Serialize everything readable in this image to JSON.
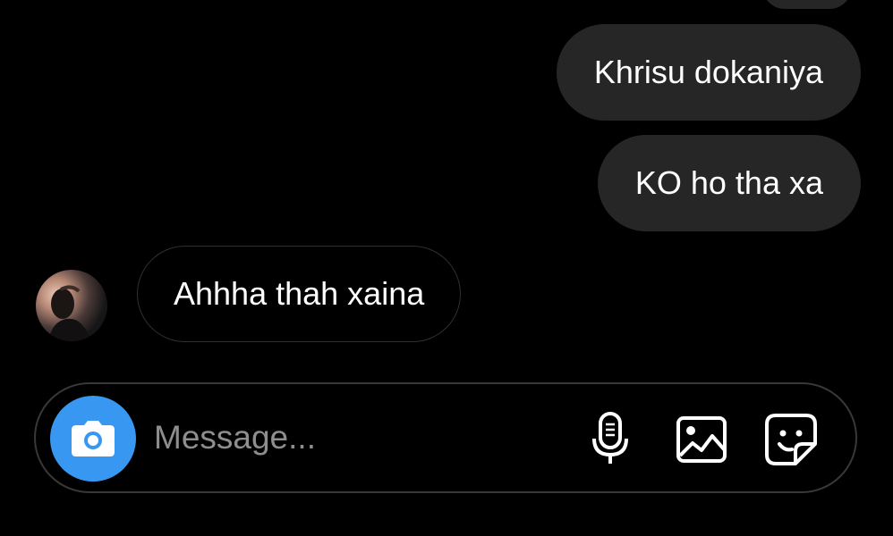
{
  "thread": {
    "outgoing": [
      {
        "text": "Khrisu dokaniya"
      },
      {
        "text": "KO ho tha xa"
      }
    ],
    "incoming": [
      {
        "text": "Ahhha thah xaina"
      }
    ]
  },
  "composer": {
    "placeholder": "Message...",
    "icons": [
      "camera-icon",
      "microphone-icon",
      "gallery-icon",
      "sticker-icon"
    ]
  },
  "colors": {
    "background": "#000000",
    "outgoing_bubble": "#262626",
    "incoming_border": "#303030",
    "camera_button": "#3897f0",
    "placeholder": "#8e8e8e"
  }
}
